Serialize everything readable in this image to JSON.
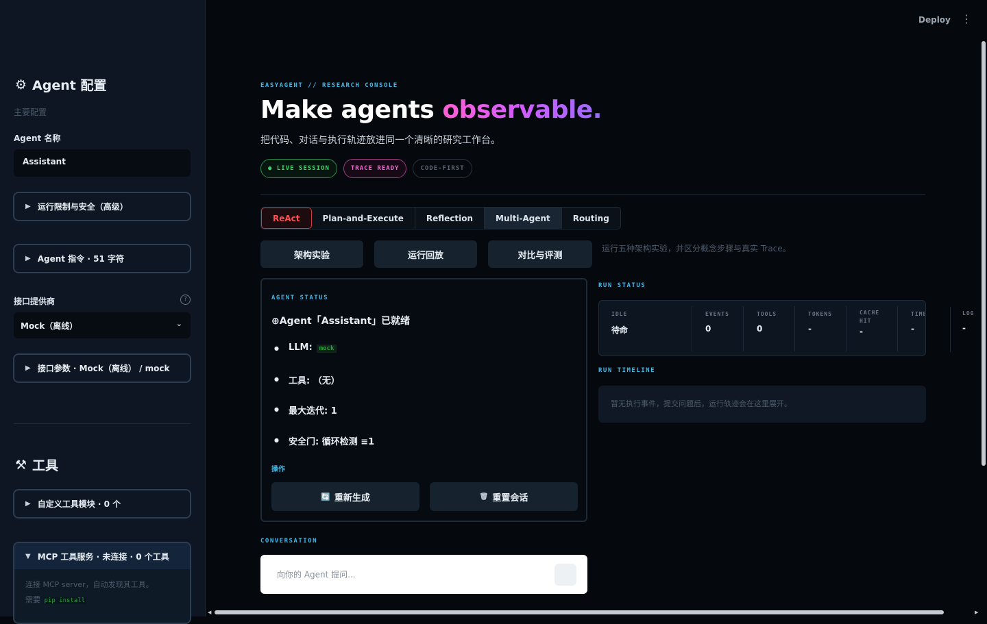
{
  "sidebar": {
    "title": "Agent 配置",
    "subtitle": "主要配置",
    "agent_name_label": "Agent 名称",
    "agent_name_value": "Assistant",
    "expander_safety": "运行限制与安全（高级）",
    "expander_prompt": "Agent 指令 · 51 字符",
    "provider_label": "接口提供商",
    "provider_value": "Mock（离线）",
    "expander_params": "接口参数 · Mock（离线） / mock",
    "tools_title": "工具",
    "expander_custom_tools": "自定义工具模块 · 0 个",
    "mcp_title": "MCP 工具服务 · 未连接 · 0 个工具",
    "mcp_desc_1": "连接 MCP server，自动发现其工具。",
    "mcp_desc_2": "需要",
    "mcp_code": "pip install"
  },
  "topbar": {
    "deploy": "Deploy",
    "menu": "⋮"
  },
  "header": {
    "eyebrow": "EASYAGENT // RESEARCH CONSOLE",
    "hero_plain": "Make agents ",
    "hero_accent": "observable.",
    "subtitle": "把代码、对话与执行轨迹放进同一个清晰的研究工作台。",
    "pills": [
      "● LIVE SESSION",
      "TRACE READY",
      "CODE-FIRST"
    ]
  },
  "tabs": [
    "ReAct",
    "Plan-and-Execute",
    "Reflection",
    "Multi-Agent",
    "Routing"
  ],
  "mode_buttons": [
    "架构实验",
    "运行回放",
    "对比与评测"
  ],
  "mode_note": "运行五种架构实验，并区分概念步骤与真实 Trace。",
  "agent_status": {
    "eyebrow": "AGENT STATUS",
    "ready": "⊕Agent「Assistant」已就绪",
    "llm_label": "LLM:",
    "llm_value": "mock",
    "tools": "工具: （无）",
    "max_iter": "最大迭代: 1",
    "safety": "安全门: 循环检测 ≡1",
    "ops_label": "操作",
    "btn_regen": "重新生成",
    "btn_reset": "重置会话"
  },
  "run_status": {
    "eyebrow": "RUN STATUS",
    "stats": [
      {
        "key": "IDLE",
        "value": "待命"
      },
      {
        "key": "EVENTS",
        "value": "0"
      },
      {
        "key": "TOOLS",
        "value": "0"
      },
      {
        "key": "TOKENS",
        "value": "-"
      },
      {
        "key": "CACHE HIT",
        "value": "-"
      },
      {
        "key": "TIME",
        "value": "-"
      },
      {
        "key": "LOG",
        "value": "-"
      }
    ]
  },
  "timeline": {
    "eyebrow": "RUN TIMELINE",
    "empty_text": "暂无执行事件，提交问题后，运行轨迹会在这里展开。"
  },
  "conversation": {
    "eyebrow": "CONVERSATION",
    "placeholder": "向你的 Agent 提问..."
  }
}
